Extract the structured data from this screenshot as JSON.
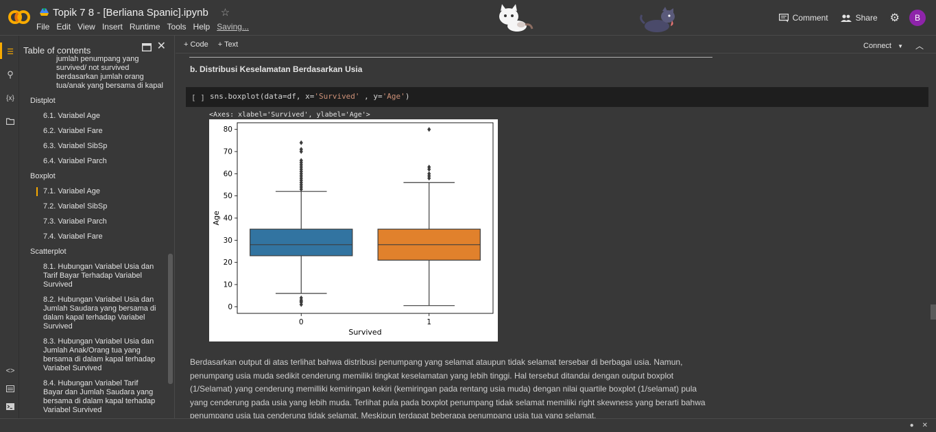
{
  "header": {
    "title": "Topik 7 8 - [Berliana Spanic].ipynb",
    "menu": [
      "File",
      "Edit",
      "View",
      "Insert",
      "Runtime",
      "Tools",
      "Help"
    ],
    "saving": "Saving...",
    "comment_label": "Comment",
    "share_label": "Share",
    "avatar_letter": "B"
  },
  "toc": {
    "title": "Table of contents",
    "items": [
      {
        "level": 2,
        "text": "jumlah penumpang yang survived/ not survived berdasarkan jumlah orang tua/anak yang bersama di kapal"
      },
      {
        "level": 1,
        "text": "Distplot"
      },
      {
        "level": 2,
        "text": "6.1. Variabel Age"
      },
      {
        "level": 2,
        "text": "6.2. Variabel Fare"
      },
      {
        "level": 2,
        "text": "6.3. Variabel SibSp"
      },
      {
        "level": 2,
        "text": "6.4. Variabel Parch"
      },
      {
        "level": 1,
        "text": "Boxplot"
      },
      {
        "level": 2,
        "text": "7.1. Variabel Age",
        "active": true
      },
      {
        "level": 2,
        "text": "7.2. Variabel SibSp"
      },
      {
        "level": 2,
        "text": "7.3. Variabel Parch"
      },
      {
        "level": 2,
        "text": "7.4. Variabel Fare"
      },
      {
        "level": 1,
        "text": "Scatterplot"
      },
      {
        "level": 2,
        "text": "8.1. Hubungan Variabel Usia dan Tarif Bayar Terhadap Variabel Survived"
      },
      {
        "level": 2,
        "text": "8.2. Hubungan Variabel Usia dan Jumlah Saudara yang bersama di dalam kapal terhadap Variabel Survived"
      },
      {
        "level": 2,
        "text": "8.3. Hubungan Variabel Usia dan Jumlah Anak/Orang tua yang bersama di dalam kapal terhadap Variabel Survived"
      },
      {
        "level": 2,
        "text": "8.4. Hubungan Variabel Tarif Bayar dan Jumlah Saudara yang bersama di dalam kapal terhadap Variabel Survived"
      }
    ]
  },
  "toolbar": {
    "code_label": "+ Code",
    "text_label": "+ Text",
    "connect_label": "Connect"
  },
  "notebook": {
    "heading": "b. Distribusi Keselamatan Berdasarkan Usia",
    "run_bracket": "[ ]",
    "code_prefix": "sns.boxplot(data=df, x=",
    "code_str1": "'Survived'",
    "code_mid": " , y=",
    "code_str2": "'Age'",
    "code_suffix": ")",
    "output_text": "<Axes: xlabel='Survived', ylabel='Age'>",
    "paragraph": "Berdasarkan output di atas terlihat bahwa distribusi penumpang yang selamat ataupun tidak selamat tersebar di berbagai usia. Namun, penumpang usia muda sedikit cenderung memiliki tingkat keselamatan yang lebih tinggi. Hal tersebut ditandai dengan output boxplot (1/Selamat) yang cenderung memilliki kemiringan kekiri (kemiringan pada rentang usia muda) dengan nilai quartile boxplot (1/selamat) pula yang cenderung pada usia yang lebih muda. Terlihat pula pada boxplot penumpang tidak selamat memiliki right skewness yang berarti bahwa penumpang usia tua cenderung tidak selamat. Meskipun terdapat beberapa penumpang usia tua yang selamat."
  },
  "chart_data": {
    "type": "boxplot",
    "xlabel": "Survived",
    "ylabel": "Age",
    "ylim": [
      -3,
      83
    ],
    "yticks": [
      0,
      10,
      20,
      30,
      40,
      50,
      60,
      70,
      80
    ],
    "categories": [
      "0",
      "1"
    ],
    "boxes": [
      {
        "category": "0",
        "color": "#3274a1",
        "whisker_low": 6,
        "q1": 23,
        "median": 28,
        "q3": 35,
        "whisker_high": 52,
        "outliers": [
          1,
          2,
          2.5,
          3,
          4,
          53,
          54,
          55,
          56,
          57,
          58,
          59,
          60,
          61,
          62,
          63,
          64,
          65,
          66,
          70,
          71,
          74
        ]
      },
      {
        "category": "1",
        "color": "#e1812c",
        "whisker_low": 0.5,
        "q1": 21,
        "median": 28,
        "q3": 35,
        "whisker_high": 56,
        "outliers": [
          58,
          59,
          60,
          62,
          63,
          80
        ]
      }
    ]
  },
  "colors": {
    "accent": "#f9ab00",
    "avatar": "#8e24aa",
    "box0": "#3274a1",
    "box1": "#e1812c"
  }
}
